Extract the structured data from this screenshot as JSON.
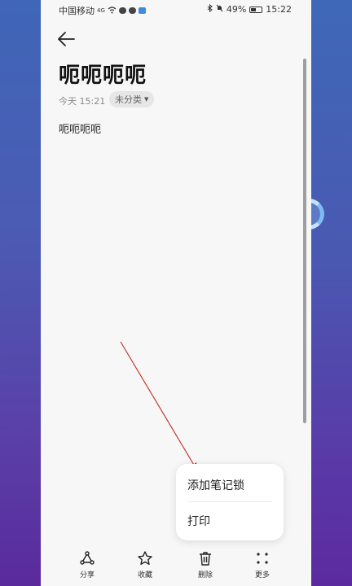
{
  "status_bar": {
    "carrier": "中国移动",
    "network": "4G",
    "battery": "49%",
    "time": "15:22"
  },
  "note": {
    "title": "呃呃呃呃",
    "time": "今天 15:21",
    "category": "未分类",
    "body": "呃呃呃呃"
  },
  "popup_menu": {
    "items": [
      "添加笔记锁",
      "打印"
    ]
  },
  "toolbar": {
    "share": "分享",
    "favorite": "收藏",
    "delete": "删除",
    "more": "更多"
  },
  "colors": {
    "annotation_line": "#c0392b",
    "loading_indicator": "#7fbcf2"
  },
  "icons": [
    "back-arrow-icon",
    "share-icon",
    "star-icon",
    "trash-icon",
    "more-dots-icon",
    "wifi-icon",
    "bluetooth-icon",
    "mute-icon",
    "battery-icon"
  ]
}
